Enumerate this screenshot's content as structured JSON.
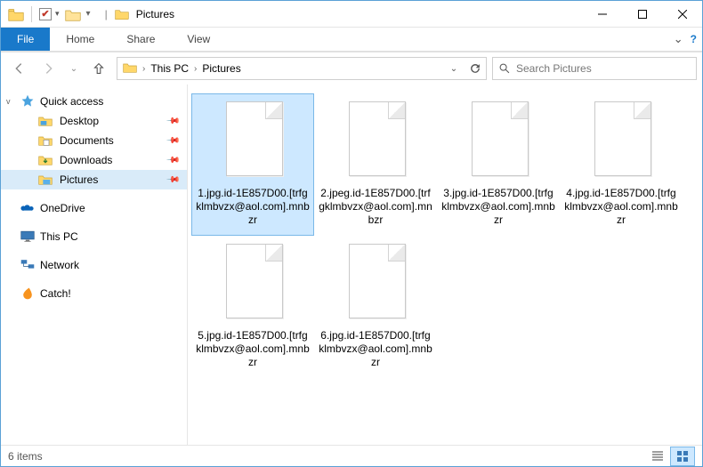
{
  "window": {
    "title": "Pictures"
  },
  "qat": {
    "checkbox_checked": true
  },
  "ribbon": {
    "file": "File",
    "tabs": [
      "Home",
      "Share",
      "View"
    ]
  },
  "nav": {
    "history_dropdown": "v",
    "up": "↑"
  },
  "address": {
    "crumbs": [
      "This PC",
      "Pictures"
    ]
  },
  "search": {
    "placeholder": "Search Pictures"
  },
  "sidebar": {
    "quick_access": "Quick access",
    "qa_items": [
      "Desktop",
      "Documents",
      "Downloads",
      "Pictures"
    ],
    "qa_selected_index": 3,
    "onedrive": "OneDrive",
    "this_pc": "This PC",
    "network": "Network",
    "catch": "Catch!"
  },
  "files": {
    "selected_index": 0,
    "items": [
      "1.jpg.id-1E857D00.[trfgklmbvzx@aol.com].mnbzr",
      "2.jpeg.id-1E857D00.[trfgklmbvzx@aol.com].mnbzr",
      "3.jpg.id-1E857D00.[trfgklmbvzx@aol.com].mnbzr",
      "4.jpg.id-1E857D00.[trfgklmbvzx@aol.com].mnbzr",
      "5.jpg.id-1E857D00.[trfgklmbvzx@aol.com].mnbzr",
      "6.jpg.id-1E857D00.[trfgklmbvzx@aol.com].mnbzr"
    ]
  },
  "status": {
    "text": "6 items"
  },
  "colors": {
    "accent": "#1979ca",
    "selection": "#cde8ff"
  }
}
